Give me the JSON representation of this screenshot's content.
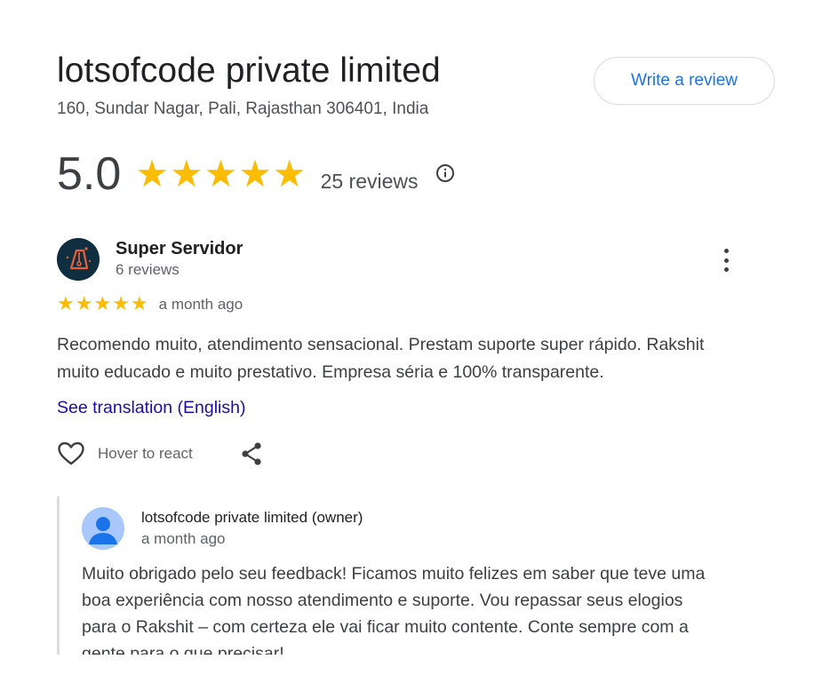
{
  "business": {
    "name": "lotsofcode private limited",
    "address": "160, Sundar Nagar, Pali, Rajasthan 306401, India",
    "write_review_label": "Write a review"
  },
  "rating": {
    "value": "5.0",
    "stars": 5,
    "reviews_label": "25 reviews",
    "star_color": "#fbbc04"
  },
  "review": {
    "author": "Super Servidor",
    "author_reviews": "6 reviews",
    "stars": 5,
    "time": "a month ago",
    "text": "Recomendo muito, atendimento sensacional. Prestam suporte super rápido. Rakshit muito educado e muito prestativo. Empresa séria e 100% transparente.",
    "translate_label": "See translation (English)",
    "react_label": "Hover to react"
  },
  "owner_reply": {
    "name": "lotsofcode private limited (owner)",
    "time": "a month ago",
    "text": "Muito obrigado pelo seu feedback! Ficamos muito felizes em saber que teve uma boa experiência com nosso atendimento e suporte. Vou repassar seus elogios para o Rakshit – com certeza ele vai ficar muito contente. Conte sempre com a gente para o que precisar!"
  },
  "icons": {
    "info": "info-icon",
    "more": "more-vert-icon",
    "heart": "heart-outline-icon",
    "share": "share-icon",
    "avatar": "pen-nib-avatar",
    "owner_avatar": "person-avatar"
  },
  "colors": {
    "link_blue": "#1a73e8",
    "translate_link": "#1a0dab",
    "owner_avatar_bg": "#a8c7fa"
  }
}
